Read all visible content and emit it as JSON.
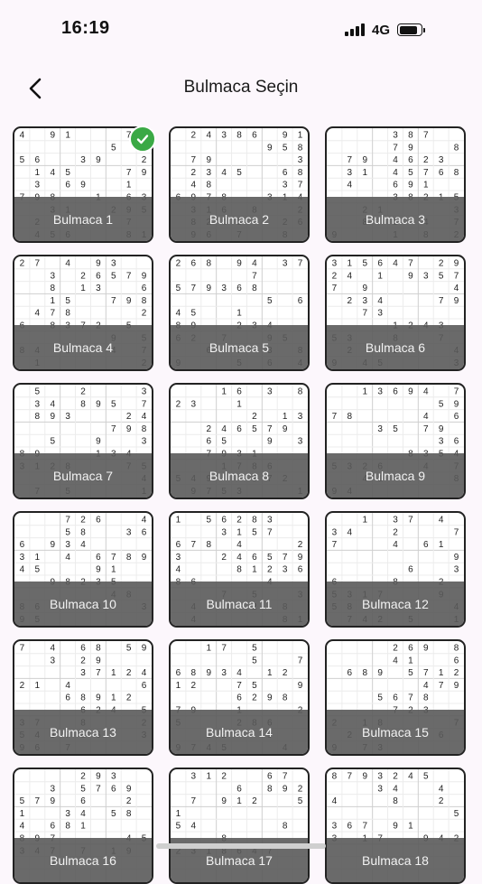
{
  "status_bar": {
    "time": "16:19",
    "network": "4G",
    "icons": [
      "signal-icon",
      "battery-icon"
    ]
  },
  "header": {
    "title": "Bulmaca Seçin",
    "back_icon": "chevron-left-icon"
  },
  "colors": {
    "background": "#fcf7fc",
    "completed_badge": "#3aa945",
    "label_overlay": "#5a5a5a",
    "card_border": "#222222"
  },
  "puzzles": [
    {
      "label": "Bulmaca 1",
      "completed": true,
      "given": [
        "4.91...7.",
        "......5.9",
        "56..39..2",
        ".145...79",
        ".3.69..1.",
        "798..1.63",
        "..31..295",
        ".2..5..7.",
        ".456...81"
      ]
    },
    {
      "label": "Bulmaca 2",
      "completed": false,
      "given": [
        ".24386.91",
        "......958",
        ".79.....3",
        ".2345..68",
        ".48....37",
        "6978..314",
        ".316.8..2",
        ".8245..26",
        ".96.7..8."
      ]
    },
    {
      "label": "Bulmaca 3",
      "completed": false,
      "given": [
        "....387..",
        "....79..8",
        ".79.4623.",
        ".31.45768",
        ".4..691..",
        "....38215",
        "..21....3",
        "..8.1.4.7",
        "9...1.8.2"
      ]
    },
    {
      "label": "Bulmaca 4",
      "completed": false,
      "given": [
        "27.4.93..",
        "..3.26579",
        "..8.13..6",
        "..15..798",
        ".478....2",
        "6.8372.5.",
        "......9.5",
        "84.5..4.7",
        ".1......2"
      ]
    },
    {
      "label": "Bulmaca 5",
      "completed": false,
      "given": [
        "268.94.37",
        ".....7...",
        "579368...",
        "......5.6",
        "45..1....",
        "89..234..",
        "62.7..95.",
        "..6.7.3.8",
        "9...5.6.4"
      ]
    },
    {
      "label": "Bulmaca 6",
      "completed": false,
      "given": [
        "315647.29",
        "24.1.9357",
        "7.9.....4",
        ".234...79",
        "..73.....",
        "....1243.",
        "53..8..7.",
        ".2..3...4",
        "9.45....3"
      ]
    },
    {
      "label": "Bulmaca 7",
      "completed": false,
      "given": [
        ".5..2...3",
        ".34.895.7",
        ".893...24",
        "......798",
        "..5..9..3",
        "89...134.",
        "3128...75",
        "...7.3..4",
        ".7.5....1"
      ]
    },
    {
      "label": "Bulmaca 8",
      "completed": false,
      "given": [
        "...16.3.8",
        "23..1....",
        ".....2.13",
        "..246579.",
        "..65..9.3",
        "..7931...",
        "...1786..",
        "549..372.",
        ".9753...1"
      ]
    },
    {
      "label": "Bulmaca 9",
      "completed": false,
      "given": [
        "..13694.7",
        ".......59",
        "78....4.6",
        "...35.79.",
        ".......36",
        ".....8354",
        "5326..4.7",
        "..41.7..8",
        "94.......3"
      ]
    },
    {
      "label": "Bulmaca 10",
      "completed": false,
      "given": [
        "...726..4",
        "...58..36",
        "6.934....",
        "31.4.6789",
        "45...91..",
        "..98235..",
        "......48.",
        "86.4.3..3",
        "95.......2"
      ]
    },
    {
      "label": "Bulmaca 11",
      "completed": false,
      "given": [
        "1.56283..",
        "...3157..",
        "678.4...2",
        "3..246579",
        "4...81236",
        "86....4..",
        "...7.5..3",
        ".4...2.8.",
        ".4.....817"
      ]
    },
    {
      "label": "Bulmaca 12",
      "completed": false,
      "given": [
        "..1.37.4.",
        "34..2...7",
        "7...4.61.",
        "........98",
        ".....6..37",
        "6...8..2.",
        "5317...9.",
        "58..4.7.4",
        ".742.5..1"
      ]
    },
    {
      "label": "Bulmaca 13",
      "completed": false,
      "given": [
        "7.4.68.59",
        "..3.29...",
        "....37124",
        "21.4....6",
        "...68912.",
        "....624.5",
        "37..8...2",
        "543786..3",
        "96.7....."
      ]
    },
    {
      "label": "Bulmaca 14",
      "completed": false,
      "given": [
        "..17.5...",
        ".....5..7",
        "68934.12.",
        "12..75..9",
        "....6298.",
        "79..1...2",
        "5...286..",
        "..82..9..",
        "9745...4."
      ]
    },
    {
      "label": "Bulmaca 15",
      "completed": false,
      "given": [
        "....269.84",
        "....41..67",
        ".689.5712",
        "......479",
        "...5678..",
        "....723..5",
        "2.18....7",
        ".2..1..6.",
        "9.73.....8"
      ]
    },
    {
      "label": "Bulmaca 16",
      "completed": false,
      "given": [
        "....293..",
        "..3.5769.",
        "579.6..2.",
        "1..34.58.",
        "4.681....",
        "897....45",
        "347.7.19.",
        "..2......",
        "........."
      ]
    },
    {
      "label": "Bulmaca 17",
      "completed": false,
      "given": [
        ".312..67.",
        "....6.8923",
        ".7.912..56",
        "1........9",
        "54.....8.",
        "...8.....",
        "2318647..",
        ".........",
        "........."
      ]
    },
    {
      "label": "Bulmaca 18",
      "completed": false,
      "given": [
        "8793245.",
        "...34..4.",
        "4...8..2.",
        "........57",
        "367.91..",
        "3.17..942",
        ".........",
        ".........",
        "........."
      ]
    }
  ]
}
